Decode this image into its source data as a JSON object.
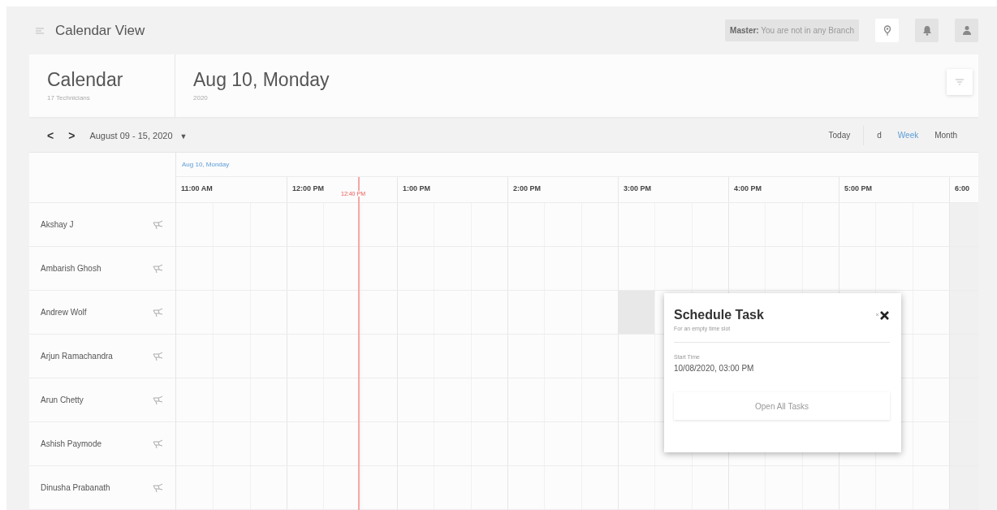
{
  "header": {
    "title": "Calendar View",
    "branch_notice": "**Master:** You are not in any Branch"
  },
  "calendar": {
    "title": "Calendar",
    "subtitle": "17 Technicians"
  },
  "day": {
    "title": "Aug 10, Monday",
    "year": "2020"
  },
  "toolbar": {
    "prev": "<",
    "next": ">",
    "range": "August 09 - 15, 2020",
    "range_caret": "▼",
    "views": [
      {
        "label": "Today",
        "selected": false
      },
      {
        "label": "d",
        "selected": false
      },
      {
        "label": "Week",
        "selected": true
      },
      {
        "label": "Month",
        "selected": false
      }
    ]
  },
  "schedule": {
    "date": "Aug 10, Monday",
    "now_label": "12:40 PM",
    "hours": [
      "11:00 AM",
      "12:00 PM",
      "1:00 PM",
      "2:00 PM",
      "3:00 PM",
      "4:00 PM",
      "5:00 PM",
      "6:00"
    ],
    "technicians": [
      {
        "name": "Akshay J",
        "selected": false
      },
      {
        "name": "Ambarish Ghosh",
        "selected": false
      },
      {
        "name": "Andrew Wolf",
        "selected": true
      },
      {
        "name": "Arjun Ramachandra",
        "selected": false
      },
      {
        "name": "Arun Chetty",
        "selected": false
      },
      {
        "name": "Ashish Paymode",
        "selected": false
      },
      {
        "name": "Dinusha Prabanath",
        "selected": false
      }
    ]
  },
  "popup": {
    "title": "Schedule Task",
    "subtitle": "For an empty time slot",
    "start_label": "Start Time",
    "start_time": "10/08/2020, 03:00 PM",
    "button": "Open All Tasks"
  }
}
